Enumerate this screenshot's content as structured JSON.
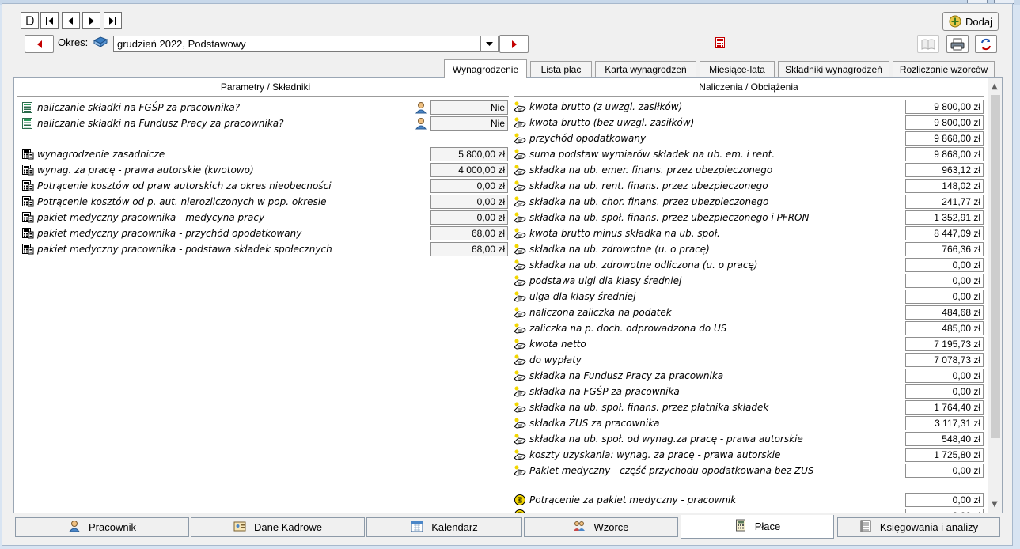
{
  "toolbar": {
    "nav_buttons": [
      "new-record",
      "first-record",
      "previous-record",
      "next-record",
      "last-record"
    ],
    "dodaj_label": "Dodaj"
  },
  "okres": {
    "label": "Okres:",
    "value": "grudzień 2022, Podstawowy"
  },
  "tabs": [
    {
      "label": "Wynagrodzenie",
      "active": true
    },
    {
      "label": "Lista płac",
      "active": false
    },
    {
      "label": "Karta wynagrodzeń",
      "active": false
    },
    {
      "label": "Miesiące-lata",
      "active": false
    },
    {
      "label": "Składniki wynagrodzeń",
      "active": false
    },
    {
      "label": "Rozliczanie wzorców",
      "active": false
    }
  ],
  "left_panel": {
    "header": "Parametry / Składniki",
    "params": [
      {
        "label": "naliczanie składki na FGŚP za pracownika?",
        "value": "Nie"
      },
      {
        "label": "naliczanie składki na Fundusz Pracy za pracownika?",
        "value": "Nie"
      }
    ],
    "components": [
      {
        "label": "wynagrodzenie zasadnicze",
        "value": "5 800,00 zł"
      },
      {
        "label": "wynag. za pracę - prawa autorskie (kwotowo)",
        "value": "4 000,00 zł"
      },
      {
        "label": "Potrącenie kosztów od praw autorskich za okres nieobecności",
        "value": "0,00 zł"
      },
      {
        "label": "Potrącenie kosztów od p. aut. nierozliczonych w pop. okresie",
        "value": "0,00 zł"
      },
      {
        "label": "pakiet medyczny pracownika - medycyna pracy",
        "value": "0,00 zł"
      },
      {
        "label": "pakiet medyczny pracownika - przychód opodatkowany",
        "value": "68,00 zł"
      },
      {
        "label": "pakiet medyczny pracownika - podstawa składek społecznych",
        "value": "68,00 zł"
      }
    ]
  },
  "right_panel": {
    "header": "Naliczenia / Obciążenia",
    "items": [
      {
        "label": "kwota brutto (z uwzgl. zasiłków)",
        "value": "9 800,00 zł"
      },
      {
        "label": "kwota brutto (bez uwzgl. zasiłków)",
        "value": "9 800,00 zł"
      },
      {
        "label": "przychód opodatkowany",
        "value": "9 868,00 zł"
      },
      {
        "label": "suma podstaw wymiarów składek na ub. em. i rent.",
        "value": "9 868,00 zł"
      },
      {
        "label": "składka na ub. emer. finans. przez ubezpieczonego",
        "value": "963,12 zł"
      },
      {
        "label": "składka na ub. rent. finans. przez ubezpieczonego",
        "value": "148,02 zł"
      },
      {
        "label": "składka na ub. chor. finans. przez ubezpieczonego",
        "value": "241,77 zł"
      },
      {
        "label": "składka na ub. społ. finans. przez ubezpieczonego i PFRON",
        "value": "1 352,91 zł"
      },
      {
        "label": "kwota brutto minus składka na ub. społ.",
        "value": "8 447,09 zł"
      },
      {
        "label": "składka na ub. zdrowotne (u. o pracę)",
        "value": "766,36 zł"
      },
      {
        "label": "składka na ub. zdrowotne odliczona (u. o pracę)",
        "value": "0,00 zł"
      },
      {
        "label": "podstawa ulgi dla klasy średniej",
        "value": "0,00 zł"
      },
      {
        "label": "ulga dla klasy średniej",
        "value": "0,00 zł"
      },
      {
        "label": "naliczona zaliczka na podatek",
        "value": "484,68 zł"
      },
      {
        "label": "zaliczka na p. doch. odprowadzona do US",
        "value": "485,00 zł"
      },
      {
        "label": "kwota netto",
        "value": "7 195,73 zł"
      },
      {
        "label": "do wypłaty",
        "value": "7 078,73 zł"
      },
      {
        "label": "składka na Fundusz Pracy za pracownika",
        "value": "0,00 zł"
      },
      {
        "label": "składka na FGŚP za pracownika",
        "value": "0,00 zł"
      },
      {
        "label": "składka na ub. społ. finans. przez płatnika składek",
        "value": "1 764,40 zł"
      },
      {
        "label": "składka ZUS za pracownika",
        "value": "3 117,31 zł"
      },
      {
        "label": "składka na ub. społ. od wynag.za pracę - prawa autorskie",
        "value": "548,40 zł"
      },
      {
        "label": "koszty uzyskania: wynag. za pracę - prawa autorskie",
        "value": "1 725,80 zł"
      },
      {
        "label": "Pakiet medyczny - część przychodu opodatkowana bez ZUS",
        "value": "0,00 zł"
      }
    ],
    "deductions": [
      {
        "label": "Potrącenie za pakiet medyczny - pracownik",
        "value": "0,00 zł"
      }
    ],
    "partial_last_value": "0,00 zł"
  },
  "bottom_tabs": [
    {
      "label": "Pracownik",
      "icon": "person-icon",
      "active": false
    },
    {
      "label": "Dane Kadrowe",
      "icon": "id-card-icon",
      "active": false
    },
    {
      "label": "Kalendarz",
      "icon": "calendar-icon",
      "active": false
    },
    {
      "label": "Wzorce",
      "icon": "people-icon",
      "active": false
    },
    {
      "label": "Płace",
      "icon": "calculator-icon",
      "active": true
    },
    {
      "label": "Księgowania i analizy",
      "icon": "ledger-icon",
      "active": false
    }
  ],
  "colors": {
    "accent_red": "#c40000",
    "frame_blue": "#d8e4f2",
    "calc_icon_yellow": "#f2d600"
  }
}
